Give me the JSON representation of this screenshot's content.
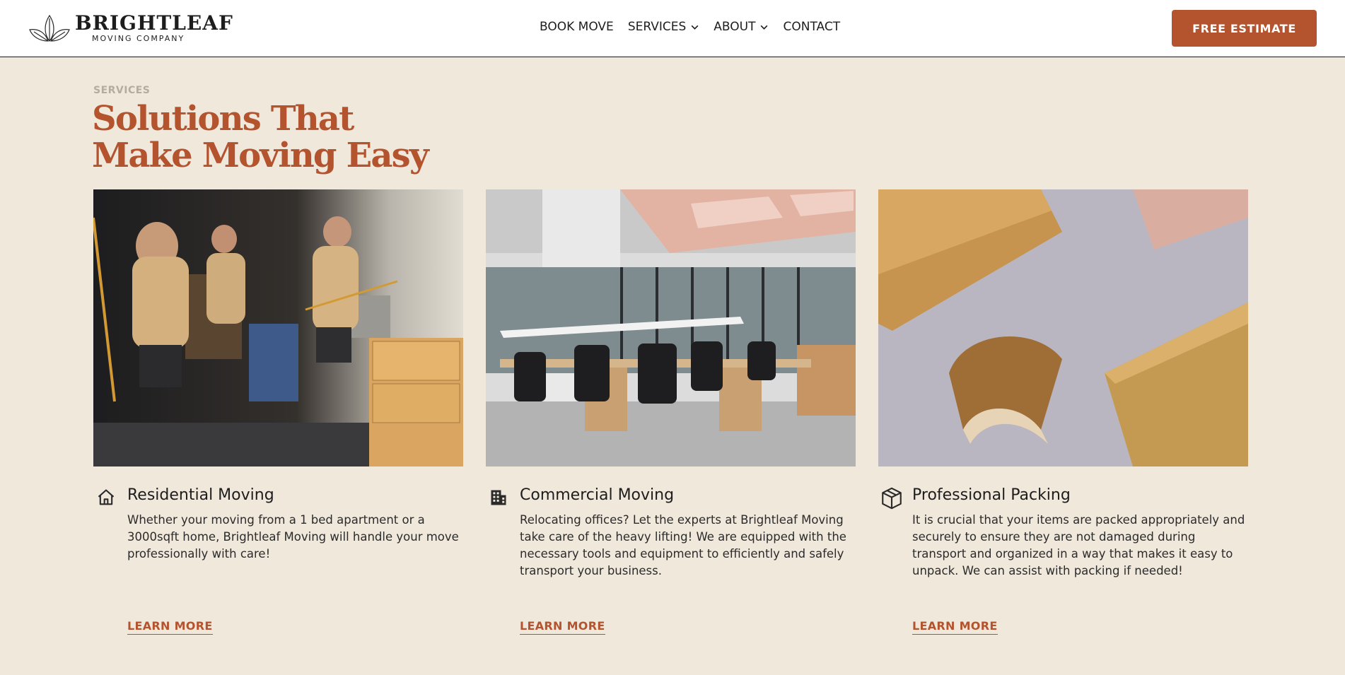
{
  "brand": {
    "name": "BRIGHTLEAF",
    "tagline": "MOVING COMPANY",
    "logo_icon": "leaf-logo-icon"
  },
  "nav": {
    "items": [
      {
        "label": "BOOK MOVE",
        "dropdown": false
      },
      {
        "label": "SERVICES",
        "dropdown": true
      },
      {
        "label": "ABOUT",
        "dropdown": true
      },
      {
        "label": "CONTACT",
        "dropdown": false
      }
    ],
    "cta_label": "FREE ESTIMATE"
  },
  "section": {
    "eyebrow": "SERVICES",
    "heading_line1": "Solutions That",
    "heading_line2": "Make Moving Easy"
  },
  "cards": [
    {
      "icon": "house-icon",
      "title": "Residential Moving",
      "description": "Whether your moving from a 1 bed apartment or a 3000sqft home, Brightleaf Moving will handle your move professionally with care!",
      "link": "LEARN MORE"
    },
    {
      "icon": "office-building-icon",
      "title": "Commercial Moving",
      "description": "Relocating offices? Let the experts at Brightleaf Moving take care of the heavy lifting! We are equipped with the necessary tools and equipment to efficiently and safely transport your business.",
      "link": "LEARN MORE"
    },
    {
      "icon": "package-box-icon",
      "title": "Professional Packing",
      "description": "It is crucial that your items are packed appropriately and securely to ensure they are not damaged during transport and organized in a way that makes it easy to unpack. We can assist with packing if needed!",
      "link": "LEARN MORE"
    }
  ],
  "colors": {
    "accent": "#b3542f",
    "background": "#f1e8dc",
    "header_bg": "#ffffff",
    "eyebrow": "#b5ab9f"
  }
}
